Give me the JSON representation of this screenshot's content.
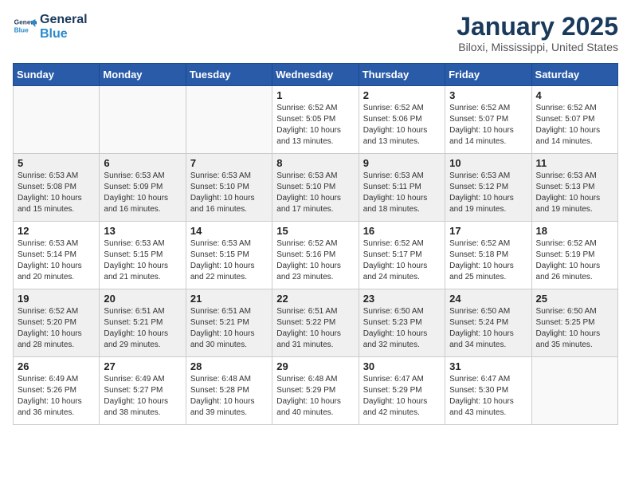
{
  "header": {
    "logo_line1": "General",
    "logo_line2": "Blue",
    "title": "January 2025",
    "subtitle": "Biloxi, Mississippi, United States"
  },
  "calendar": {
    "days_of_week": [
      "Sunday",
      "Monday",
      "Tuesday",
      "Wednesday",
      "Thursday",
      "Friday",
      "Saturday"
    ],
    "weeks": [
      [
        {
          "day": "",
          "info": ""
        },
        {
          "day": "",
          "info": ""
        },
        {
          "day": "",
          "info": ""
        },
        {
          "day": "1",
          "info": "Sunrise: 6:52 AM\nSunset: 5:05 PM\nDaylight: 10 hours\nand 13 minutes."
        },
        {
          "day": "2",
          "info": "Sunrise: 6:52 AM\nSunset: 5:06 PM\nDaylight: 10 hours\nand 13 minutes."
        },
        {
          "day": "3",
          "info": "Sunrise: 6:52 AM\nSunset: 5:07 PM\nDaylight: 10 hours\nand 14 minutes."
        },
        {
          "day": "4",
          "info": "Sunrise: 6:52 AM\nSunset: 5:07 PM\nDaylight: 10 hours\nand 14 minutes."
        }
      ],
      [
        {
          "day": "5",
          "info": "Sunrise: 6:53 AM\nSunset: 5:08 PM\nDaylight: 10 hours\nand 15 minutes."
        },
        {
          "day": "6",
          "info": "Sunrise: 6:53 AM\nSunset: 5:09 PM\nDaylight: 10 hours\nand 16 minutes."
        },
        {
          "day": "7",
          "info": "Sunrise: 6:53 AM\nSunset: 5:10 PM\nDaylight: 10 hours\nand 16 minutes."
        },
        {
          "day": "8",
          "info": "Sunrise: 6:53 AM\nSunset: 5:10 PM\nDaylight: 10 hours\nand 17 minutes."
        },
        {
          "day": "9",
          "info": "Sunrise: 6:53 AM\nSunset: 5:11 PM\nDaylight: 10 hours\nand 18 minutes."
        },
        {
          "day": "10",
          "info": "Sunrise: 6:53 AM\nSunset: 5:12 PM\nDaylight: 10 hours\nand 19 minutes."
        },
        {
          "day": "11",
          "info": "Sunrise: 6:53 AM\nSunset: 5:13 PM\nDaylight: 10 hours\nand 19 minutes."
        }
      ],
      [
        {
          "day": "12",
          "info": "Sunrise: 6:53 AM\nSunset: 5:14 PM\nDaylight: 10 hours\nand 20 minutes."
        },
        {
          "day": "13",
          "info": "Sunrise: 6:53 AM\nSunset: 5:15 PM\nDaylight: 10 hours\nand 21 minutes."
        },
        {
          "day": "14",
          "info": "Sunrise: 6:53 AM\nSunset: 5:15 PM\nDaylight: 10 hours\nand 22 minutes."
        },
        {
          "day": "15",
          "info": "Sunrise: 6:52 AM\nSunset: 5:16 PM\nDaylight: 10 hours\nand 23 minutes."
        },
        {
          "day": "16",
          "info": "Sunrise: 6:52 AM\nSunset: 5:17 PM\nDaylight: 10 hours\nand 24 minutes."
        },
        {
          "day": "17",
          "info": "Sunrise: 6:52 AM\nSunset: 5:18 PM\nDaylight: 10 hours\nand 25 minutes."
        },
        {
          "day": "18",
          "info": "Sunrise: 6:52 AM\nSunset: 5:19 PM\nDaylight: 10 hours\nand 26 minutes."
        }
      ],
      [
        {
          "day": "19",
          "info": "Sunrise: 6:52 AM\nSunset: 5:20 PM\nDaylight: 10 hours\nand 28 minutes."
        },
        {
          "day": "20",
          "info": "Sunrise: 6:51 AM\nSunset: 5:21 PM\nDaylight: 10 hours\nand 29 minutes."
        },
        {
          "day": "21",
          "info": "Sunrise: 6:51 AM\nSunset: 5:21 PM\nDaylight: 10 hours\nand 30 minutes."
        },
        {
          "day": "22",
          "info": "Sunrise: 6:51 AM\nSunset: 5:22 PM\nDaylight: 10 hours\nand 31 minutes."
        },
        {
          "day": "23",
          "info": "Sunrise: 6:50 AM\nSunset: 5:23 PM\nDaylight: 10 hours\nand 32 minutes."
        },
        {
          "day": "24",
          "info": "Sunrise: 6:50 AM\nSunset: 5:24 PM\nDaylight: 10 hours\nand 34 minutes."
        },
        {
          "day": "25",
          "info": "Sunrise: 6:50 AM\nSunset: 5:25 PM\nDaylight: 10 hours\nand 35 minutes."
        }
      ],
      [
        {
          "day": "26",
          "info": "Sunrise: 6:49 AM\nSunset: 5:26 PM\nDaylight: 10 hours\nand 36 minutes."
        },
        {
          "day": "27",
          "info": "Sunrise: 6:49 AM\nSunset: 5:27 PM\nDaylight: 10 hours\nand 38 minutes."
        },
        {
          "day": "28",
          "info": "Sunrise: 6:48 AM\nSunset: 5:28 PM\nDaylight: 10 hours\nand 39 minutes."
        },
        {
          "day": "29",
          "info": "Sunrise: 6:48 AM\nSunset: 5:29 PM\nDaylight: 10 hours\nand 40 minutes."
        },
        {
          "day": "30",
          "info": "Sunrise: 6:47 AM\nSunset: 5:29 PM\nDaylight: 10 hours\nand 42 minutes."
        },
        {
          "day": "31",
          "info": "Sunrise: 6:47 AM\nSunset: 5:30 PM\nDaylight: 10 hours\nand 43 minutes."
        },
        {
          "day": "",
          "info": ""
        }
      ]
    ]
  }
}
